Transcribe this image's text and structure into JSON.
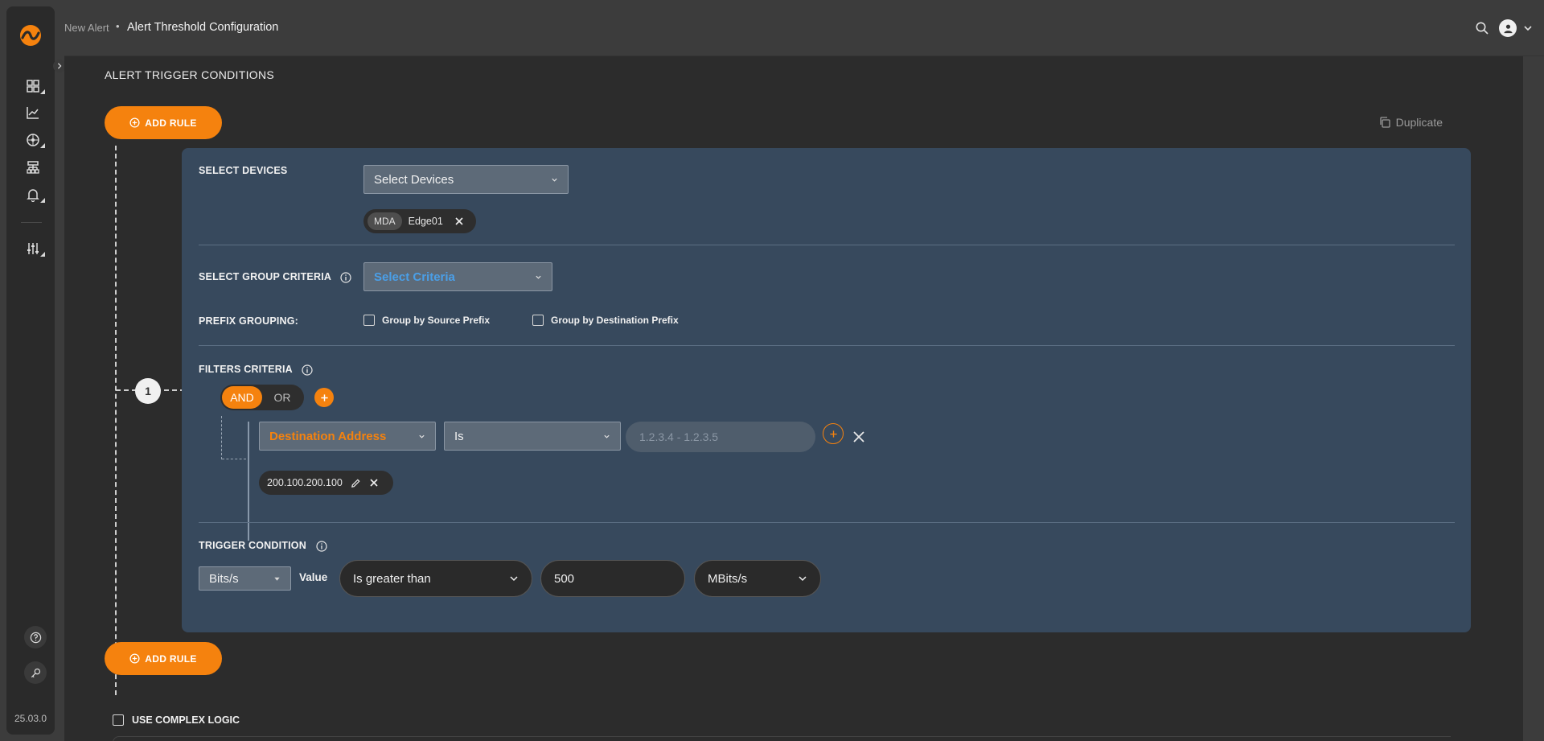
{
  "app": {
    "version": "25.03.0"
  },
  "breadcrumb": {
    "previous": "New Alert",
    "separator": "•",
    "current": "Alert Threshold Configuration"
  },
  "sidebar": {
    "items": [
      {
        "icon": "dashboard-icon"
      },
      {
        "icon": "chart-line-icon"
      },
      {
        "icon": "network-icon"
      },
      {
        "icon": "sitemap-icon"
      },
      {
        "icon": "bell-icon"
      },
      {
        "icon": "sliders-icon"
      }
    ],
    "bottom": [
      {
        "icon": "help-icon"
      },
      {
        "icon": "key-icon"
      }
    ]
  },
  "main": {
    "section_title": "ALERT TRIGGER CONDITIONS",
    "add_rule_label": "ADD RULE",
    "duplicate_label": "Duplicate",
    "rule_number": "1",
    "use_complex_logic_label": "USE COMPLEX LOGIC"
  },
  "rule": {
    "devices": {
      "label": "SELECT DEVICES",
      "placeholder": "Select Devices",
      "chip": {
        "tag": "MDA",
        "name": "Edge01"
      }
    },
    "group_criteria": {
      "label": "SELECT GROUP CRITERIA",
      "placeholder": "Select Criteria"
    },
    "prefix_grouping": {
      "label": "PREFIX GROUPING:",
      "options": [
        "Group by Source Prefix",
        "Group by Destination Prefix"
      ]
    },
    "filters": {
      "label": "FILTERS CRITERIA",
      "logic": {
        "and": "AND",
        "or": "OR",
        "selected": "AND"
      },
      "field": "Destination Address",
      "operator": "Is",
      "value_placeholder": "1.2.3.4 - 1.2.3.5",
      "value_chip": "200.100.200.100"
    },
    "trigger": {
      "label": "TRIGGER CONDITION",
      "metric": "Bits/s",
      "value_label": "Value",
      "comparator": "Is greater than",
      "threshold": "500",
      "unit": "MBits/s"
    }
  },
  "colors": {
    "accent": "#f5820e",
    "card": "#37495d",
    "canvas": "#2c2c2c",
    "criteria_text": "#4a9fe8"
  }
}
